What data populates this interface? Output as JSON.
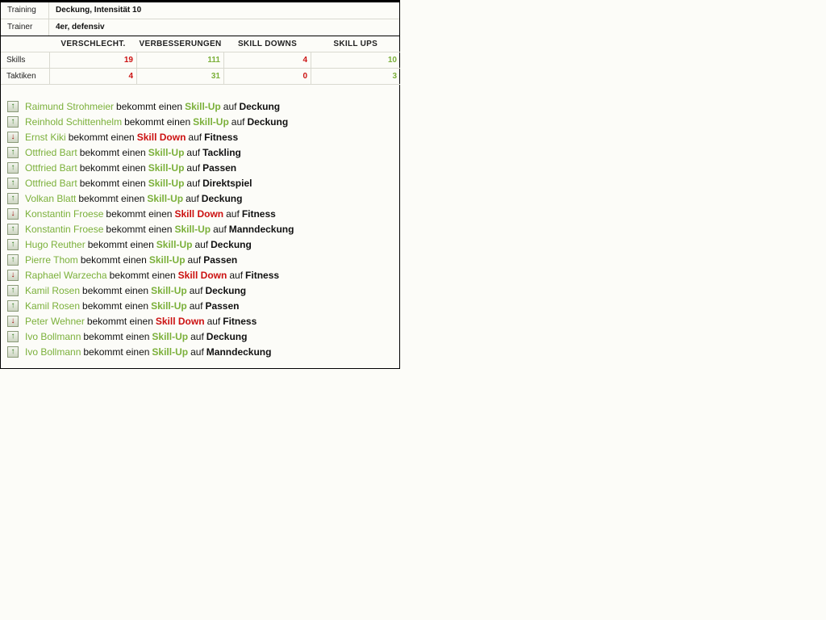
{
  "info": {
    "training_label": "Training",
    "training_value": "Deckung, Intensität 10",
    "trainer_label": "Trainer",
    "trainer_value": "4er, defensiv"
  },
  "stats": {
    "headers": [
      "VERSCHLECHT.",
      "VERBESSERUNGEN",
      "SKILL DOWNS",
      "SKILL UPS"
    ],
    "rows": [
      {
        "label": "Skills",
        "values": [
          "19",
          "111",
          "4",
          "10"
        ]
      },
      {
        "label": "Taktiken",
        "values": [
          "4",
          "31",
          "0",
          "3"
        ]
      }
    ],
    "colors": {
      "negative": "#cc1111",
      "positive": "#7bb03a"
    }
  },
  "events": {
    "verb": "bekommt einen",
    "prep": "auf",
    "items": [
      {
        "player": "Raimund Strohmeier",
        "type": "up",
        "label": "Skill-Up",
        "skill": "Deckung"
      },
      {
        "player": "Reinhold Schittenhelm",
        "type": "up",
        "label": "Skill-Up",
        "skill": "Deckung"
      },
      {
        "player": "Ernst Kiki",
        "type": "down",
        "label": "Skill Down",
        "skill": "Fitness"
      },
      {
        "player": "Ottfried Bart",
        "type": "up",
        "label": "Skill-Up",
        "skill": "Tackling"
      },
      {
        "player": "Ottfried Bart",
        "type": "up",
        "label": "Skill-Up",
        "skill": "Passen"
      },
      {
        "player": "Ottfried Bart",
        "type": "up",
        "label": "Skill-Up",
        "skill": "Direktspiel"
      },
      {
        "player": "Volkan Blatt",
        "type": "up",
        "label": "Skill-Up",
        "skill": "Deckung"
      },
      {
        "player": "Konstantin Froese",
        "type": "down",
        "label": "Skill Down",
        "skill": "Fitness"
      },
      {
        "player": "Konstantin Froese",
        "type": "up",
        "label": "Skill-Up",
        "skill": "Manndeckung"
      },
      {
        "player": "Hugo Reuther",
        "type": "up",
        "label": "Skill-Up",
        "skill": "Deckung"
      },
      {
        "player": "Pierre Thom",
        "type": "up",
        "label": "Skill-Up",
        "skill": "Passen"
      },
      {
        "player": "Raphael Warzecha",
        "type": "down",
        "label": "Skill Down",
        "skill": "Fitness"
      },
      {
        "player": "Kamil Rosen",
        "type": "up",
        "label": "Skill-Up",
        "skill": "Deckung"
      },
      {
        "player": "Kamil Rosen",
        "type": "up",
        "label": "Skill-Up",
        "skill": "Passen"
      },
      {
        "player": "Peter Wehner",
        "type": "down",
        "label": "Skill Down",
        "skill": "Fitness"
      },
      {
        "player": "Ivo Bollmann",
        "type": "up",
        "label": "Skill-Up",
        "skill": "Deckung"
      },
      {
        "player": "Ivo Bollmann",
        "type": "up",
        "label": "Skill-Up",
        "skill": "Manndeckung"
      }
    ]
  }
}
